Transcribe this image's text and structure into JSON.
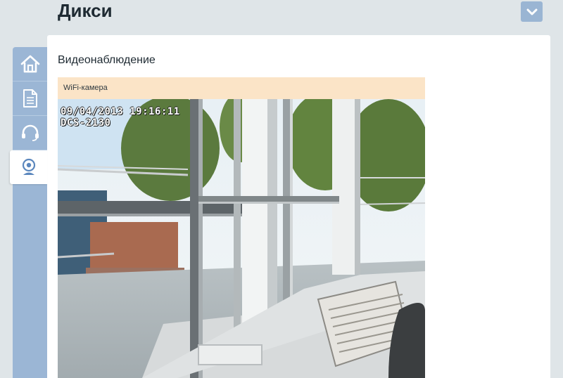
{
  "header": {
    "title": "Дикси",
    "collapse_icon": "chevron-down-icon"
  },
  "sidebar": {
    "items": [
      {
        "icon": "home-icon",
        "active": false
      },
      {
        "icon": "document-icon",
        "active": false
      },
      {
        "icon": "headset-icon",
        "active": false
      },
      {
        "icon": "webcam-icon",
        "active": true
      }
    ]
  },
  "main": {
    "section_title": "Видеонаблюдение",
    "camera": {
      "name": "WiFi-камера",
      "overlay_datetime": "09/04/2013 19:16:11",
      "overlay_model": "DCS-2130"
    }
  },
  "colors": {
    "sidebar": "#9bb6d5",
    "header_accent": "#9ab5d3",
    "camera_header": "#fbe4c7",
    "background": "#dfe5e8"
  }
}
